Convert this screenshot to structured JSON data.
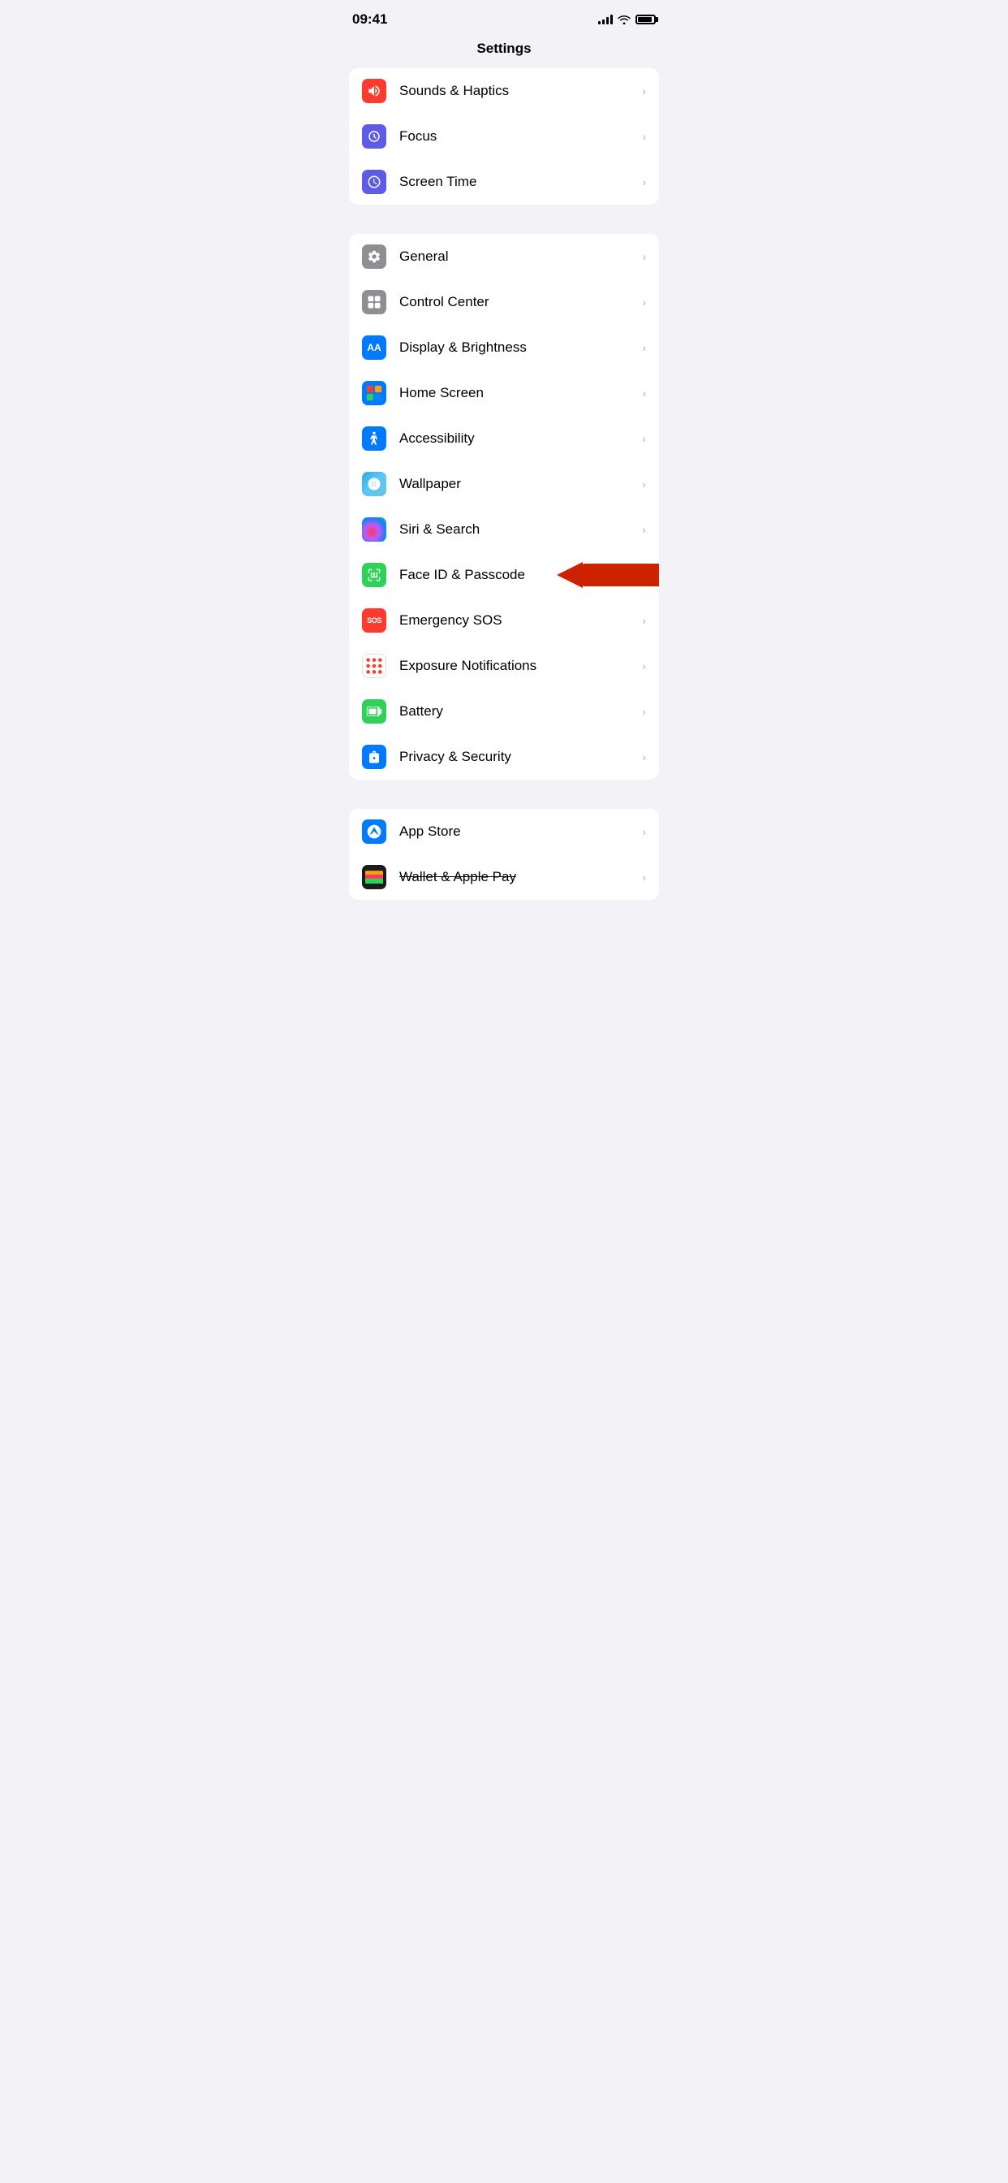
{
  "statusBar": {
    "time": "09:41"
  },
  "pageTitle": "Settings",
  "groups": [
    {
      "id": "group1",
      "items": [
        {
          "id": "sounds",
          "label": "Sounds & Haptics",
          "iconClass": "icon-sounds",
          "iconSymbol": "🔊",
          "hasChevron": true
        },
        {
          "id": "focus",
          "label": "Focus",
          "iconClass": "icon-focus",
          "iconSymbol": "🌙",
          "hasChevron": true
        },
        {
          "id": "screentime",
          "label": "Screen Time",
          "iconClass": "icon-screentime",
          "iconSymbol": "⏳",
          "hasChevron": true
        }
      ]
    },
    {
      "id": "group2",
      "items": [
        {
          "id": "general",
          "label": "General",
          "iconClass": "icon-general",
          "iconSymbol": "⚙️",
          "hasChevron": true
        },
        {
          "id": "controlcenter",
          "label": "Control Center",
          "iconClass": "icon-controlcenter",
          "iconSymbol": "🎛",
          "hasChevron": true
        },
        {
          "id": "display",
          "label": "Display & Brightness",
          "iconClass": "icon-display",
          "iconSymbol": "AA",
          "hasChevron": true
        },
        {
          "id": "homescreen",
          "label": "Home Screen",
          "iconClass": "icon-homescreen",
          "iconSymbol": "⊞",
          "hasChevron": true
        },
        {
          "id": "accessibility",
          "label": "Accessibility",
          "iconClass": "icon-accessibility",
          "iconSymbol": "♿",
          "hasChevron": true
        },
        {
          "id": "wallpaper",
          "label": "Wallpaper",
          "iconClass": "icon-wallpaper",
          "iconSymbol": "❀",
          "hasChevron": true
        },
        {
          "id": "siri",
          "label": "Siri & Search",
          "iconClass": "siri-gradient",
          "iconSymbol": "siri",
          "hasChevron": true
        },
        {
          "id": "faceid",
          "label": "Face ID & Passcode",
          "iconClass": "icon-faceid",
          "iconSymbol": "faceid",
          "hasChevron": false,
          "hasArrow": true
        },
        {
          "id": "sos",
          "label": "Emergency SOS",
          "iconClass": "icon-sos",
          "iconSymbol": "SOS",
          "hasChevron": true
        },
        {
          "id": "exposure",
          "label": "Exposure Notifications",
          "iconClass": "exposure-icon",
          "iconSymbol": "exposure",
          "hasChevron": true
        },
        {
          "id": "battery",
          "label": "Battery",
          "iconClass": "icon-battery",
          "iconSymbol": "battery",
          "hasChevron": true
        },
        {
          "id": "privacy",
          "label": "Privacy & Security",
          "iconClass": "icon-privacy",
          "iconSymbol": "✋",
          "hasChevron": true
        }
      ]
    },
    {
      "id": "group3",
      "items": [
        {
          "id": "appstore",
          "label": "App Store",
          "iconClass": "icon-appstore",
          "iconSymbol": "A",
          "hasChevron": true
        },
        {
          "id": "wallet",
          "label": "Wallet & Apple Pay",
          "iconClass": "icon-wallet",
          "iconSymbol": "wallet",
          "hasChevron": true,
          "strikethrough": true
        }
      ]
    }
  ]
}
